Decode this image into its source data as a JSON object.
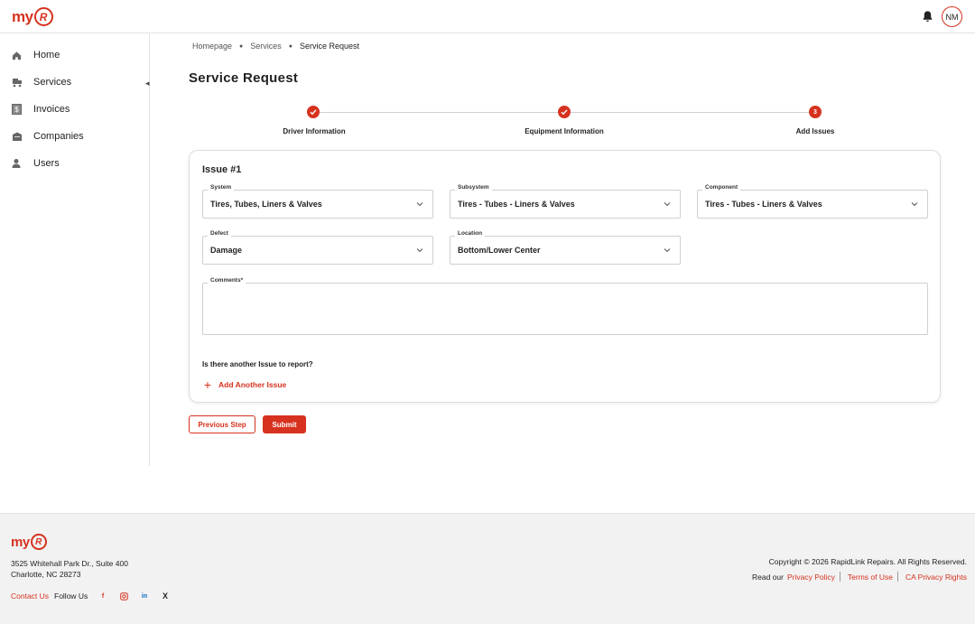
{
  "header": {
    "logo_text": "my",
    "logo_badge": "R",
    "avatar_initials": "NM"
  },
  "sidebar": {
    "items": [
      {
        "label": "Home",
        "icon": "home-icon"
      },
      {
        "label": "Services",
        "icon": "truck-icon"
      },
      {
        "label": "Invoices",
        "icon": "invoice-dollar-icon"
      },
      {
        "label": "Companies",
        "icon": "building-icon"
      },
      {
        "label": "Users",
        "icon": "users-icon"
      }
    ]
  },
  "breadcrumb": {
    "items": [
      "Homepage",
      "Services",
      "Service Request"
    ]
  },
  "page_title": "Service Request",
  "stepper": {
    "steps": [
      {
        "label": "Driver Information",
        "status": "complete"
      },
      {
        "label": "Equipment Information",
        "status": "complete"
      },
      {
        "label": "Add Issues",
        "status": "current",
        "number": "3"
      }
    ]
  },
  "issue": {
    "title": "Issue #1",
    "fields": {
      "system": {
        "label": "System",
        "value": "Tires, Tubes, Liners & Valves"
      },
      "subsystem": {
        "label": "Subsystem",
        "value": "Tires - Tubes - Liners & Valves"
      },
      "component": {
        "label": "Component",
        "value": "Tires - Tubes - Liners & Valves"
      },
      "defect": {
        "label": "Defect",
        "value": "Damage"
      },
      "location": {
        "label": "Location",
        "value": "Bottom/Lower Center"
      },
      "comments": {
        "label": "Comments*",
        "value": ""
      }
    },
    "question": "Is there another Issue to report?",
    "add_another": "Add Another Issue"
  },
  "actions": {
    "previous": "Previous Step",
    "submit": "Submit"
  },
  "footer": {
    "address_line1": "3525 Whitehall Park Dr., Suite 400",
    "address_line2": "Charlotte, NC 28273",
    "contact_us": "Contact Us",
    "follow_us": "Follow Us",
    "social": [
      "f",
      "ig",
      "in",
      "X"
    ],
    "copyright": "Copyright © 2026 RapidLink Repairs. All Rights Reserved.",
    "read_our": "Read our",
    "privacy_policy": "Privacy Policy",
    "terms_of_use": "Terms of Use",
    "ca_privacy": "CA Privacy Rights"
  },
  "colors": {
    "accent": "#d6321f",
    "border": "#cfcfcf",
    "footer_bg": "#f2f2f2"
  }
}
